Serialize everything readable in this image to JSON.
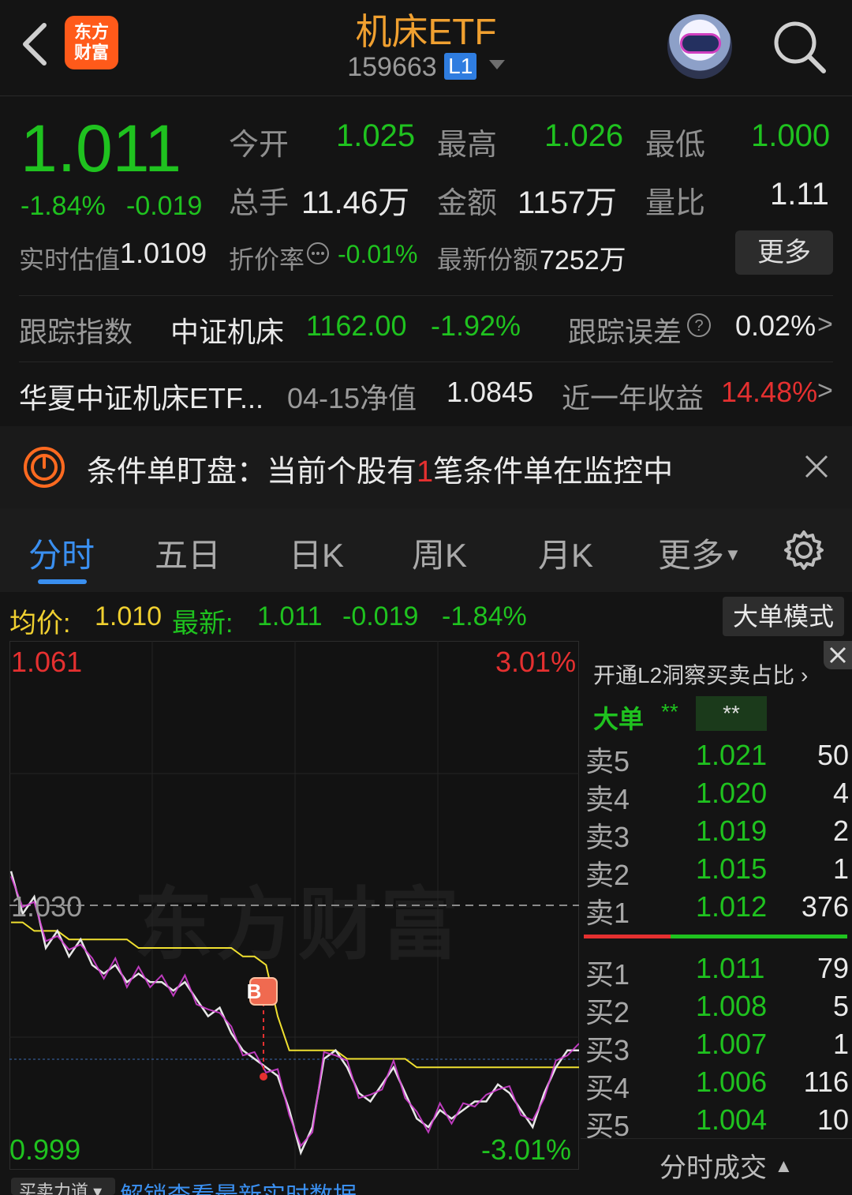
{
  "header": {
    "title": "机床ETF",
    "code": "159663",
    "level": "L1",
    "logo_text_line1": "东方",
    "logo_text_line2": "财富"
  },
  "quote": {
    "price": "1.011",
    "change_pct": "-1.84%",
    "change": "-0.019",
    "open_label": "今开",
    "open": "1.025",
    "high_label": "最高",
    "high": "1.026",
    "low_label": "最低",
    "low": "1.000",
    "volume_label": "总手",
    "volume": "11.46万",
    "amount_label": "金额",
    "amount": "1157万",
    "vol_ratio_label": "量比",
    "vol_ratio": "1.11",
    "iopv_label": "实时估值",
    "iopv": "1.0109",
    "discount_label": "折价率",
    "discount": "-0.01%",
    "shares_label": "最新份额",
    "shares": "7252万",
    "more_label": "更多"
  },
  "tracking": {
    "index_label": "跟踪指数",
    "index_name": "中证机床",
    "index_value": "1162.00",
    "index_change": "-1.92%",
    "error_label": "跟踪误差",
    "error_value": "0.02%",
    "chevron": ">"
  },
  "fund": {
    "name": "华夏中证机床ETF...",
    "nav_date_label": "04-15净值",
    "nav": "1.0845",
    "return_label": "近一年收益",
    "return_value": "14.48%",
    "chevron": ">"
  },
  "condition": {
    "text_prefix": "条件单盯盘：当前个股有",
    "count": "1",
    "text_suffix": "笔条件单在监控中"
  },
  "tabs": [
    "分时",
    "五日",
    "日K",
    "周K",
    "月K",
    "更多"
  ],
  "info_strip": {
    "avg_label": "均价:",
    "avg": "1.010",
    "latest_label": "最新:",
    "latest": "1.011",
    "change": "-0.019",
    "change_pct": "-1.84%",
    "big_order_mode": "大单模式"
  },
  "chart_labels": {
    "top_price": "1.061",
    "top_pct": "3.01%",
    "mid_price": "1.030",
    "bottom_price": "0.999",
    "bottom_pct": "-3.01%",
    "marker": "B",
    "watermark": "东方财富",
    "bottom_left": "买卖力道",
    "bottom_link": "解锁查看最新实时数据"
  },
  "chart_data": {
    "type": "line",
    "ylim": [
      0.999,
      1.061
    ],
    "series": [
      {
        "values": [
          1.034,
          1.029,
          1.031,
          1.025,
          1.027,
          1.024,
          1.026,
          1.023,
          1.022,
          1.023,
          1.021,
          1.022,
          1.021,
          1.021,
          1.02,
          1.021,
          1.019,
          1.017,
          1.018,
          1.015,
          1.013,
          1.012,
          1.011,
          1.01,
          1.006,
          1.001,
          1.004,
          1.012,
          1.013,
          1.011,
          1.008,
          1.007,
          1.009,
          1.011,
          1.008,
          1.005,
          1.004,
          1.006,
          1.005,
          1.006,
          1.007,
          1.007,
          1.009,
          1.008,
          1.006,
          1.004,
          1.008,
          1.011,
          1.013,
          1.013
        ]
      },
      {
        "values": [
          1.028,
          1.028,
          1.027,
          1.027,
          1.027,
          1.026,
          1.026,
          1.026,
          1.026,
          1.026,
          1.026,
          1.025,
          1.025,
          1.025,
          1.025,
          1.025,
          1.025,
          1.025,
          1.025,
          1.025,
          1.024,
          1.024,
          1.023,
          1.017,
          1.013,
          1.013,
          1.013,
          1.013,
          1.013,
          1.012,
          1.012,
          1.012,
          1.012,
          1.012,
          1.012,
          1.011,
          1.011,
          1.011,
          1.011,
          1.011,
          1.011,
          1.011,
          1.011,
          1.011,
          1.011,
          1.011,
          1.011,
          1.011,
          1.011,
          1.011
        ]
      }
    ]
  },
  "side_panel": {
    "l2_label": "开通L2洞察买卖占比",
    "big_label": "大单",
    "stars": "**",
    "sells": [
      {
        "label": "卖5",
        "price": "1.021",
        "vol": "50"
      },
      {
        "label": "卖4",
        "price": "1.020",
        "vol": "4"
      },
      {
        "label": "卖3",
        "price": "1.019",
        "vol": "2"
      },
      {
        "label": "卖2",
        "price": "1.015",
        "vol": "1"
      },
      {
        "label": "卖1",
        "price": "1.012",
        "vol": "376"
      }
    ],
    "buys": [
      {
        "label": "买1",
        "price": "1.011",
        "vol": "79"
      },
      {
        "label": "买2",
        "price": "1.008",
        "vol": "5"
      },
      {
        "label": "买3",
        "price": "1.007",
        "vol": "1"
      },
      {
        "label": "买4",
        "price": "1.006",
        "vol": "116"
      },
      {
        "label": "买5",
        "price": "1.004",
        "vol": "10"
      }
    ],
    "trades_label": "分时成交"
  },
  "colors": {
    "up": "#e53030",
    "down": "#1fc21f",
    "accent": "#3a8ff0",
    "title": "#f0a030"
  }
}
